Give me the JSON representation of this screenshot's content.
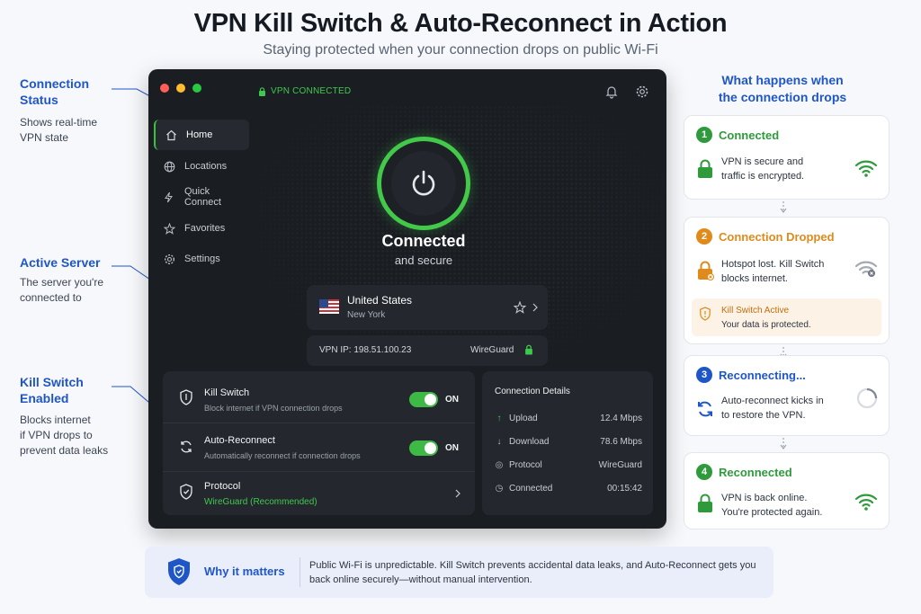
{
  "header": {
    "title": "VPN Kill Switch & Auto-Reconnect in Action",
    "subtitle": "Staying protected when your connection drops on public Wi-Fi"
  },
  "callouts": [
    {
      "title_line1": "Connection",
      "title_line2": "Status",
      "desc_line1": "Shows real-time",
      "desc_line2": "VPN state"
    },
    {
      "title_line1": "Active Server",
      "title_line2": "",
      "desc_line1": "The server you're",
      "desc_line2": "connected to"
    },
    {
      "title_line1": "Kill Switch",
      "title_line2": "Enabled",
      "desc_line1": "Blocks internet",
      "desc_line2": "if VPN drops to",
      "desc_line3": "prevent data leaks"
    }
  ],
  "app": {
    "status_label": "VPN CONNECTED",
    "nav": [
      {
        "label": "Home",
        "icon": "home-icon",
        "active": true
      },
      {
        "label": "Locations",
        "icon": "globe-icon"
      },
      {
        "label": "Quick Connect",
        "icon": "bolt-icon"
      },
      {
        "label": "Favorites",
        "icon": "star-icon"
      },
      {
        "label": "Settings",
        "icon": "gear-icon"
      }
    ],
    "connection": {
      "title": "Connected",
      "subtitle": "and secure"
    },
    "server": {
      "country": "United States",
      "city": "New York"
    },
    "ip": {
      "label": "VPN IP: 198.51.100.23",
      "protocol": "WireGuard"
    },
    "kill_switch": {
      "title": "Kill Switch",
      "desc": "Block internet if VPN connection drops",
      "state": "ON"
    },
    "auto_reconnect": {
      "title": "Auto-Reconnect",
      "desc": "Automatically reconnect if connection drops",
      "state": "ON"
    },
    "protocol": {
      "title": "Protocol",
      "value": "WireGuard (Recommended)"
    },
    "details": {
      "title": "Connection Details",
      "rows": [
        {
          "label": "Upload",
          "value": "12.4 Mbps",
          "icon": "arrow-up-icon"
        },
        {
          "label": "Download",
          "value": "78.6 Mbps",
          "icon": "arrow-down-icon"
        },
        {
          "label": "Protocol",
          "value": "WireGuard",
          "icon": "protocol-icon"
        },
        {
          "label": "Connected",
          "value": "00:15:42",
          "icon": "clock-icon"
        }
      ]
    },
    "colors": {
      "accent": "#43c94a",
      "background": "#1a1d22"
    }
  },
  "right_panel": {
    "heading_line1": "What happens when",
    "heading_line2": "the connection drops",
    "steps": [
      {
        "num": "1",
        "title": "Connected",
        "line1": "VPN is secure and",
        "line2": "traffic is encrypted.",
        "color": "#2e9a3b"
      },
      {
        "num": "2",
        "title": "Connection Dropped",
        "line1": "Hotspot lost. Kill Switch",
        "line2": "blocks internet.",
        "color": "#e08a1c",
        "alert_title": "Kill Switch Active",
        "alert_text": "Your data is protected."
      },
      {
        "num": "3",
        "title": "Reconnecting...",
        "line1": "Auto-reconnect kicks in",
        "line2": "to restore the VPN.",
        "color": "#1f56c7"
      },
      {
        "num": "4",
        "title": "Reconnected",
        "line1": "VPN is back online.",
        "line2": "You're protected again.",
        "color": "#2e9a3b"
      }
    ]
  },
  "why": {
    "title": "Why it matters",
    "text": "Public Wi-Fi is unpredictable. Kill Switch prevents accidental data leaks, and Auto-Reconnect gets you back online securely—without manual intervention."
  }
}
